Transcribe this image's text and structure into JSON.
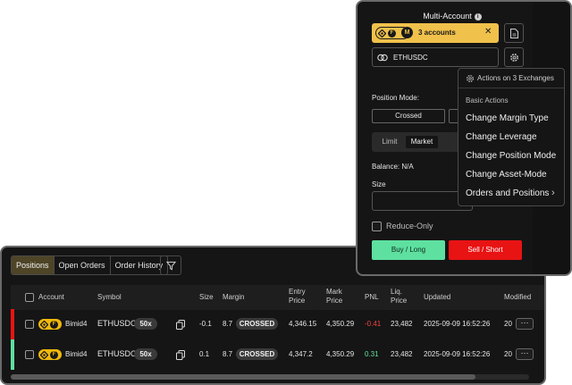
{
  "positions": {
    "tabs": [
      "Positions",
      "Open Orders",
      "Order History"
    ],
    "columns": {
      "account": "Account",
      "symbol": "Symbol",
      "size": "Size",
      "margin": "Margin",
      "entry_price_1": "Entry",
      "entry_price_2": "Price",
      "mark_price_1": "Mark",
      "mark_price_2": "Price",
      "pnl": "PNL",
      "liq_price_1": "Liq.",
      "liq_price_2": "Price",
      "updated": "Updated",
      "modified": "Modified"
    },
    "rows": [
      {
        "account": "Bimid4",
        "exchange_badge": "F",
        "symbol": "ETHUSDC",
        "leverage": "50x",
        "size": "-0.1",
        "margin": "8.7",
        "margin_mode": "CROSSED",
        "entry_price": "4,346.15",
        "mark_price": "4,350.29",
        "pnl": "-0.41",
        "liq_price": "23,482",
        "updated": "2025-09-09 16:52:26",
        "modified": "20",
        "side_color": "#e81313",
        "pnl_color": "#f04444"
      },
      {
        "account": "Bimid4",
        "exchange_badge": "F",
        "symbol": "ETHUSDC",
        "leverage": "50x",
        "size": "0.1",
        "margin": "8.7",
        "margin_mode": "CROSSED",
        "entry_price": "4,347.2",
        "mark_price": "4,350.29",
        "pnl": "0.31",
        "liq_price": "23,482",
        "updated": "2025-09-09 16:52:26",
        "modified": "20",
        "side_color": "#5ee0a0",
        "pnl_color": "#5ee0a0"
      }
    ],
    "more_label": "⋯"
  },
  "multi_account": {
    "title": "Multi-Account",
    "info_glyph": "i",
    "badge_letters": [
      "F",
      "M"
    ],
    "accounts_label": "3 accounts",
    "clear_glyph": "✕",
    "symbol": "ETHUSDC",
    "position_mode_label": "Position Mode:",
    "position_mode_value": "Crossed",
    "order_type_tabs": [
      "Limit",
      "Market"
    ],
    "balance_label": "Balance:",
    "balance_value": "N/A",
    "size_label": "Size",
    "reduce_only_label": "Reduce-Only",
    "buy_label": "Buy / Long",
    "sell_label": "Sell / Short"
  },
  "menu": {
    "header": "Actions on 3 Exchanges",
    "section": "Basic Actions",
    "items": [
      "Change Margin Type",
      "Change Leverage",
      "Change Position Mode",
      "Change Asset-Mode",
      "Orders and Positions"
    ],
    "submenu_glyph": "›"
  },
  "colors": {
    "accent": "#f0c14b",
    "buy": "#5ee0a0",
    "sell": "#e81313"
  }
}
